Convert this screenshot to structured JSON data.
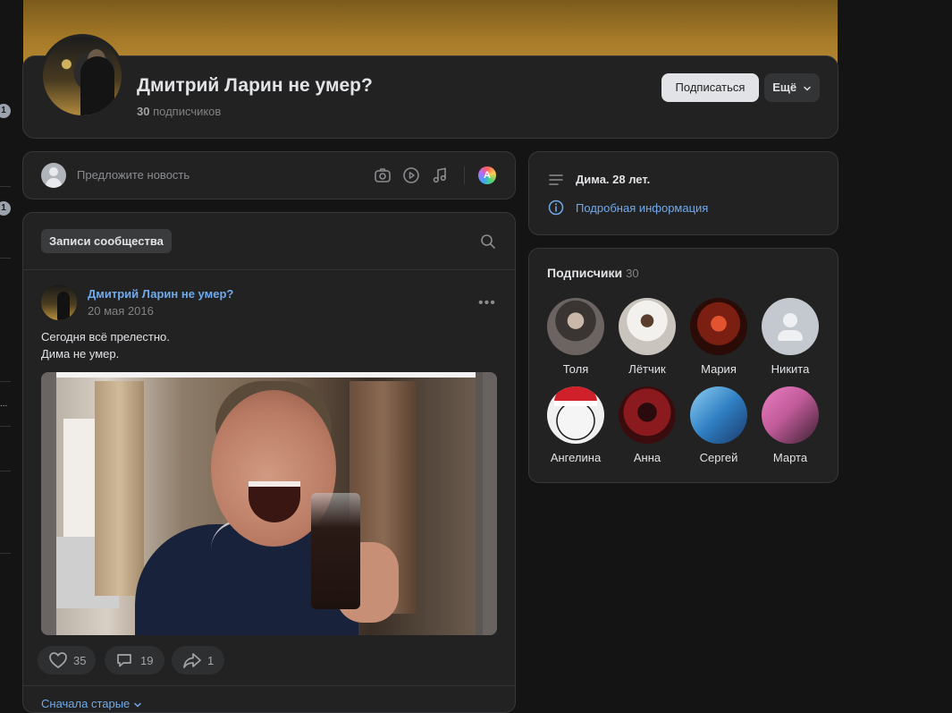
{
  "sidebar": {
    "badges": [
      "1",
      "1"
    ],
    "ellipsis": "..."
  },
  "header": {
    "title": "Дмитрий Ларин не умер?",
    "subscribers_count": "30",
    "subscribers_label": "подписчиков",
    "subscribe_button": "Подписаться",
    "more_button": "Ещё"
  },
  "suggest": {
    "placeholder": "Предложите новость",
    "ai_icon_letter": "A"
  },
  "posts": {
    "tab_label": "Записи сообщества",
    "post": {
      "author": "Дмитрий Ларин не умер?",
      "date": "20 мая 2016",
      "text_lines": [
        "Сегодня всё прелестно.",
        "Дима не умер."
      ],
      "likes": "35",
      "comments": "19",
      "shares": "1"
    },
    "sort_label": "Сначала старые"
  },
  "info": {
    "description": "Дима. 28 лет.",
    "details_link": "Подробная информация"
  },
  "followers": {
    "title": "Подписчики",
    "count": "30",
    "items": [
      {
        "name": "Толя",
        "color": "#3a3532"
      },
      {
        "name": "Лётчик",
        "color": "#e8e6e2"
      },
      {
        "name": "Мария",
        "color": "#7a1f12"
      },
      {
        "name": "Никита",
        "color": "#c4c9d0"
      },
      {
        "name": "Ангелина",
        "color": "#f2f2f2"
      },
      {
        "name": "Анна",
        "color": "#8a1a1e"
      },
      {
        "name": "Сергей",
        "color": "#2f7fc2"
      },
      {
        "name": "Марта",
        "color": "#c25b9a"
      }
    ]
  },
  "colors": {
    "accent_link": "#71aaeb",
    "card_bg": "#222222",
    "page_bg": "#141414"
  },
  "icons": [
    "camera-icon",
    "play-icon",
    "music-icon",
    "search-icon",
    "more-dots-icon",
    "heart-icon",
    "comment-icon",
    "share-icon",
    "menu-lines-icon",
    "info-icon",
    "chevron-down-icon"
  ]
}
